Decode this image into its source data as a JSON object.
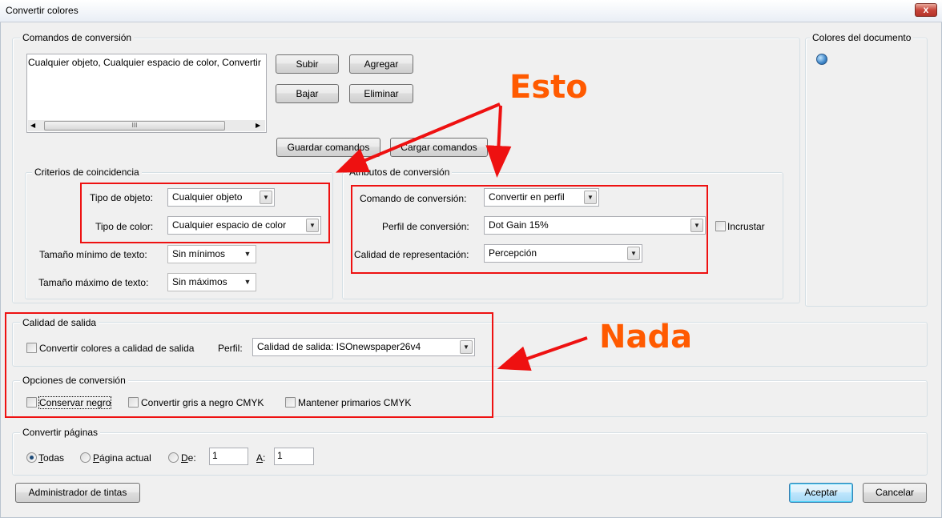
{
  "window": {
    "title": "Convertir colores",
    "close_label": "x"
  },
  "commands": {
    "group_label": "Comandos de conversión",
    "list_item": "Cualquier objeto, Cualquier espacio de color, Convertir",
    "scroll_grip": "III",
    "subir": "Subir",
    "agregar": "Agregar",
    "bajar": "Bajar",
    "eliminar": "Eliminar",
    "guardar": "Guardar comandos",
    "cargar": "Cargar comandos"
  },
  "criteria": {
    "group_label": "Criterios de coincidencia",
    "tipo_objeto_label": "Tipo de objeto:",
    "tipo_objeto_value": "Cualquier objeto",
    "tipo_color_label": "Tipo de color:",
    "tipo_color_value": "Cualquier espacio de color",
    "tam_min_label": "Tamaño mínimo de texto:",
    "tam_min_value": "Sin mínimos",
    "tam_max_label": "Tamaño máximo de texto:",
    "tam_max_value": "Sin máximos"
  },
  "attributes": {
    "group_label": "Atributos de conversión",
    "comando_label": "Comando de conversión:",
    "comando_value": "Convertir en perfil",
    "perfil_label": "Perfil de conversión:",
    "perfil_value": "Dot Gain 15%",
    "incrustar_label": "Incrustar",
    "calidad_label": "Calidad de representación:",
    "calidad_value": "Percepción"
  },
  "doc_colors": {
    "group_label": "Colores del documento"
  },
  "output": {
    "group_label": "Calidad de salida",
    "convertir_label": "Convertir colores a calidad de salida",
    "perfil_label": "Perfil:",
    "perfil_value": "Calidad de salida: ISOnewspaper26v4"
  },
  "options": {
    "group_label": "Opciones de conversión",
    "conservar_negro": "Conservar negro",
    "convertir_gris": "Convertir gris a negro CMYK",
    "mantener_primarios": "Mantener primarios CMYK"
  },
  "pages": {
    "group_label": "Convertir páginas",
    "todas_u": "T",
    "todas_rest": "odas",
    "pagina_u": "P",
    "pagina_rest": "ágina actual",
    "de_u": "D",
    "de_rest": "e:",
    "de_value": "1",
    "a_u": "A",
    "a_rest": ":",
    "a_value": "1"
  },
  "footer": {
    "ink_manager": "Administrador de tintas",
    "accept": "Aceptar",
    "cancel": "Cancelar"
  },
  "annotations": {
    "esto": "Esto",
    "nada": "Nada",
    "color": "#ff5a00",
    "box_color": "#ee1111"
  }
}
